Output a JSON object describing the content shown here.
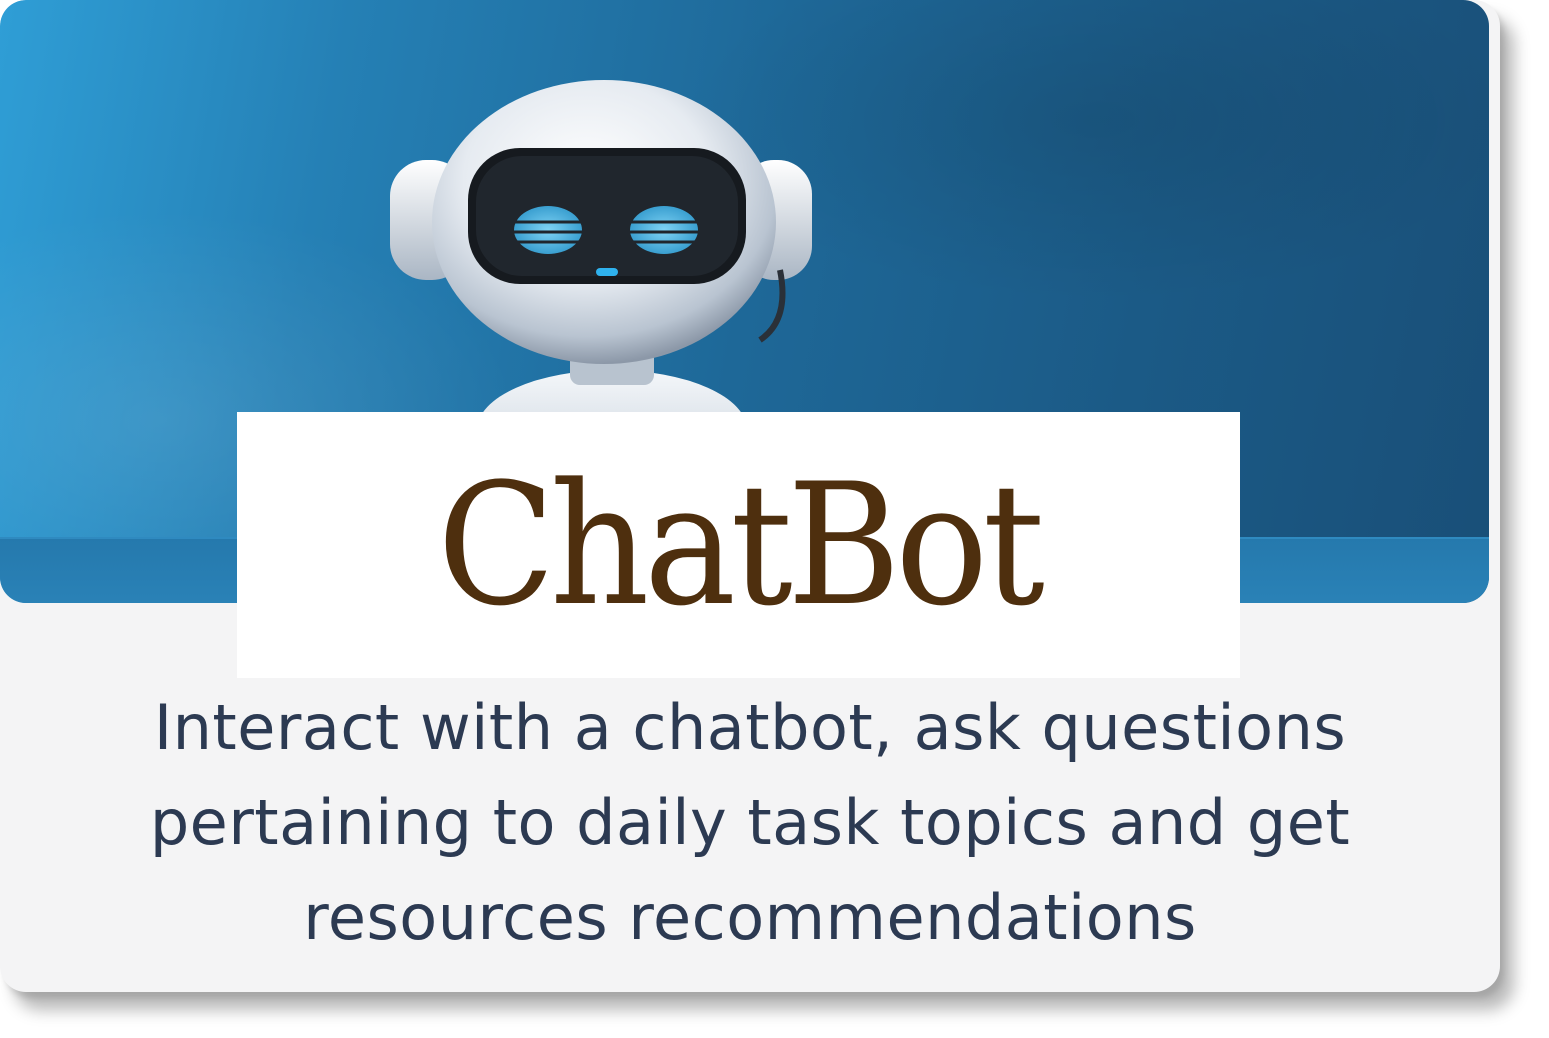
{
  "card": {
    "title": "ChatBot",
    "description": "Interact with a chatbot, ask questions pertaining to daily task topics and get resources recommendations",
    "image_icon": "robot-icon"
  },
  "colors": {
    "banner": "#1f6a9c",
    "title": "#4e2f0e",
    "description": "#2c3a52",
    "card_background": "#f4f4f5"
  }
}
